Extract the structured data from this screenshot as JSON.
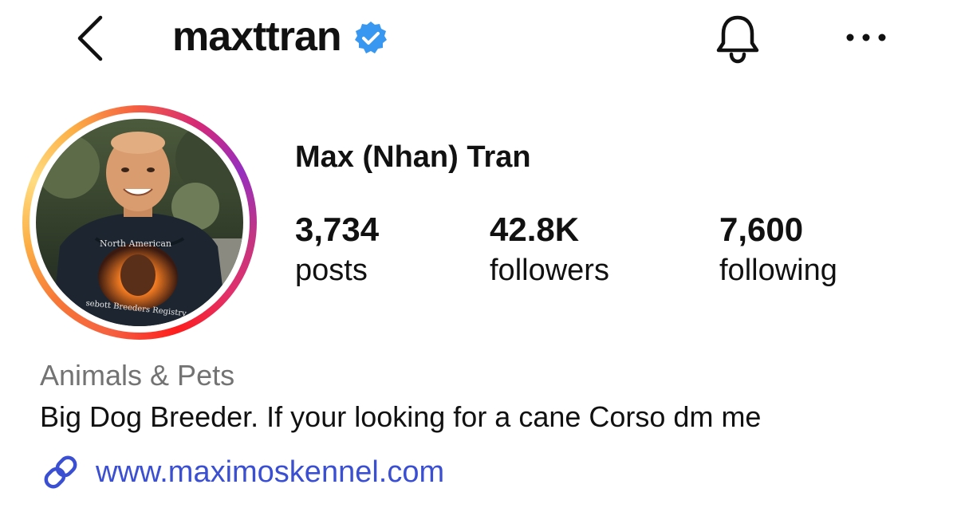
{
  "header": {
    "username": "maxttran",
    "verified": true
  },
  "profile": {
    "display_name": "Max (Nhan) Tran",
    "avatar_shirt_text_top": "North American",
    "avatar_shirt_text_bottom": "sebott Breeders Registry"
  },
  "stats": [
    {
      "number": "3,734",
      "label": "posts"
    },
    {
      "number": "42.8K",
      "label": "followers"
    },
    {
      "number": "7,600",
      "label": "following"
    }
  ],
  "bio": {
    "category": "Animals & Pets",
    "text": "Big Dog Breeder. If your looking for a cane Corso dm me",
    "link": "www.maximoskennel.com"
  },
  "icons": {
    "back": "chevron-left-icon",
    "verified": "verified-badge-icon",
    "bell": "bell-icon",
    "more": "more-horizontal-icon",
    "link": "link-icon"
  },
  "colors": {
    "verified_blue": "#3897f0",
    "link_blue": "#3a4fd1",
    "category_gray": "#737373"
  }
}
